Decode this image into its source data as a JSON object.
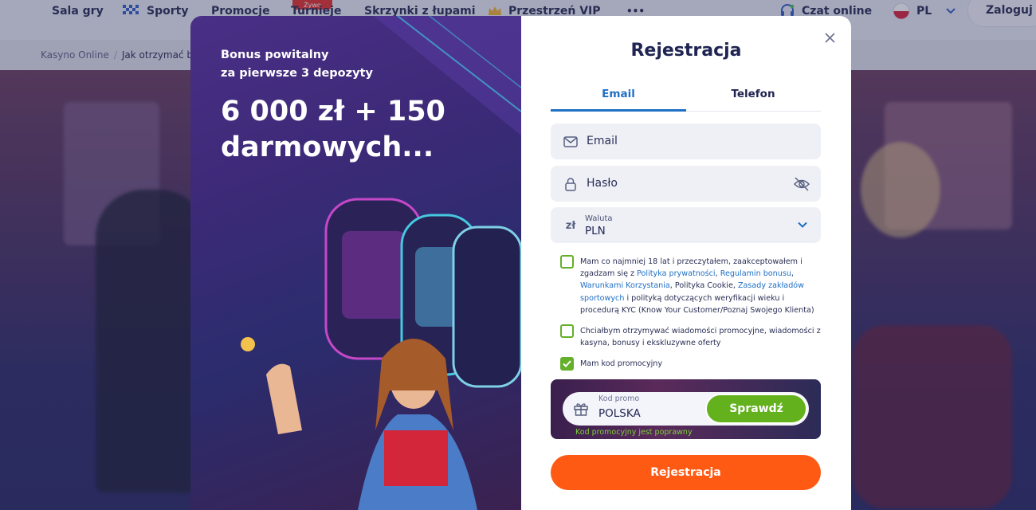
{
  "topnav": {
    "items": [
      "Sala gry",
      "Sporty",
      "Promocje",
      "Turnieje",
      "Skrzynki z łupami",
      "Przestrzeń VIP"
    ],
    "more_label": "•••",
    "live_badge": "Żywo",
    "chat_label": "Czat online",
    "language": "PL",
    "login_label": "Zaloguj",
    "icons": [
      "sport-flag-icon",
      "crown-icon",
      "chat-headset-icon",
      "poland-flag-icon",
      "chevron-down-icon"
    ]
  },
  "breadcrumb": {
    "home": "Kasyno Online",
    "separator": "/",
    "current": "Jak otrzymać bon"
  },
  "promo": {
    "subtitle_line1": "Bonus powitalny",
    "subtitle_line2": "za pierwsze 3 depozyty",
    "headline_line1": "6 000 zł + 150",
    "headline_line2": "darmowych..."
  },
  "form": {
    "title": "Rejestracja",
    "tabs": [
      {
        "label": "Email",
        "active": true
      },
      {
        "label": "Telefon",
        "active": false
      }
    ],
    "email_placeholder": "Email",
    "password_placeholder": "Hasło",
    "currency_label": "Waluta",
    "currency_value": "PLN",
    "currency_symbol": "zł",
    "consent1": {
      "t1": "Mam co najmniej 18 lat i przeczytałem, zaakceptowałem i zgadzam się z ",
      "l1": "Polityka prywatności",
      "t2": ", ",
      "l2": "Regulamin bonusu",
      "t3": ", ",
      "l3": "Warunkami Korzystania",
      "t4": ", Polityka Cookie, ",
      "l4": "Zasady zakładów sportowych",
      "t5": " i polityką dotyczących weryfikacji wieku i procedurą KYC (Know Your Customer/Poznaj Swojego Klienta)",
      "checked": false
    },
    "consent2": {
      "text": "Chciałbym otrzymywać wiadomości promocyjne, wiadomości z kasyna, bonusy i ekskluzywne oferty",
      "checked": false
    },
    "promo_code_toggle": {
      "text": "Mam kod promocyjny",
      "checked": true
    },
    "promo_code": {
      "label": "Kod promo",
      "value": "POLSKA",
      "button": "Sprawdź",
      "status": "Kod promocyjny jest poprawny"
    },
    "submit_label": "Rejestracja"
  },
  "colors": {
    "accent_blue": "#1f6fc5",
    "submit_orange": "#ff5a14",
    "check_green": "#63b21d",
    "title_navy": "#1f2452"
  }
}
